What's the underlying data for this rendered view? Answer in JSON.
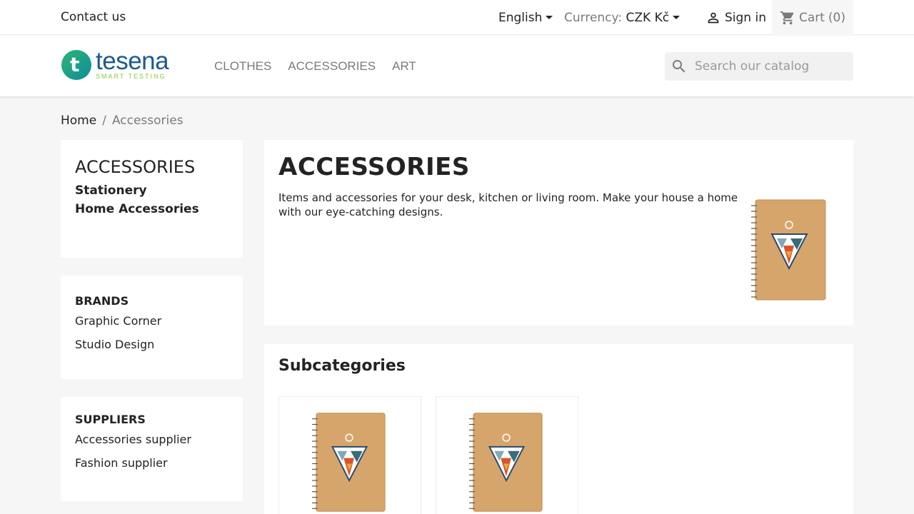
{
  "topbar": {
    "contact": "Contact us",
    "language": "English",
    "currency_label": "Currency:",
    "currency_value": "CZK Kč",
    "signin": "Sign in",
    "cart": "Cart",
    "cart_count": "(0)"
  },
  "header": {
    "logo_name": "tesena",
    "logo_tagline": "SMART TESTING",
    "nav": [
      "CLOTHES",
      "ACCESSORIES",
      "ART"
    ],
    "search_placeholder": "Search our catalog"
  },
  "breadcrumb": {
    "home": "Home",
    "separator": "/",
    "current": "Accessories"
  },
  "sidebar": {
    "category_title": "ACCESSORIES",
    "categories": [
      "Stationery",
      "Home Accessories"
    ],
    "brands_title": "BRANDS",
    "brands": [
      "Graphic Corner",
      "Studio Design"
    ],
    "suppliers_title": "SUPPLIERS",
    "suppliers": [
      "Accessories supplier",
      "Fashion supplier"
    ]
  },
  "main": {
    "title": "ACCESSORIES",
    "description": "Items and accessories for your desk, kitchen or living room. Make your house a home with our eye-catching designs.",
    "subcategories_title": "Subcategories"
  },
  "colors": {
    "logo_blue": "#1a5b8e",
    "logo_green": "#8cc63f",
    "notebook_kraft": "#d6a56c"
  },
  "icons": {
    "signin": "person-icon",
    "cart": "shopping-cart-icon",
    "search": "search-icon"
  }
}
